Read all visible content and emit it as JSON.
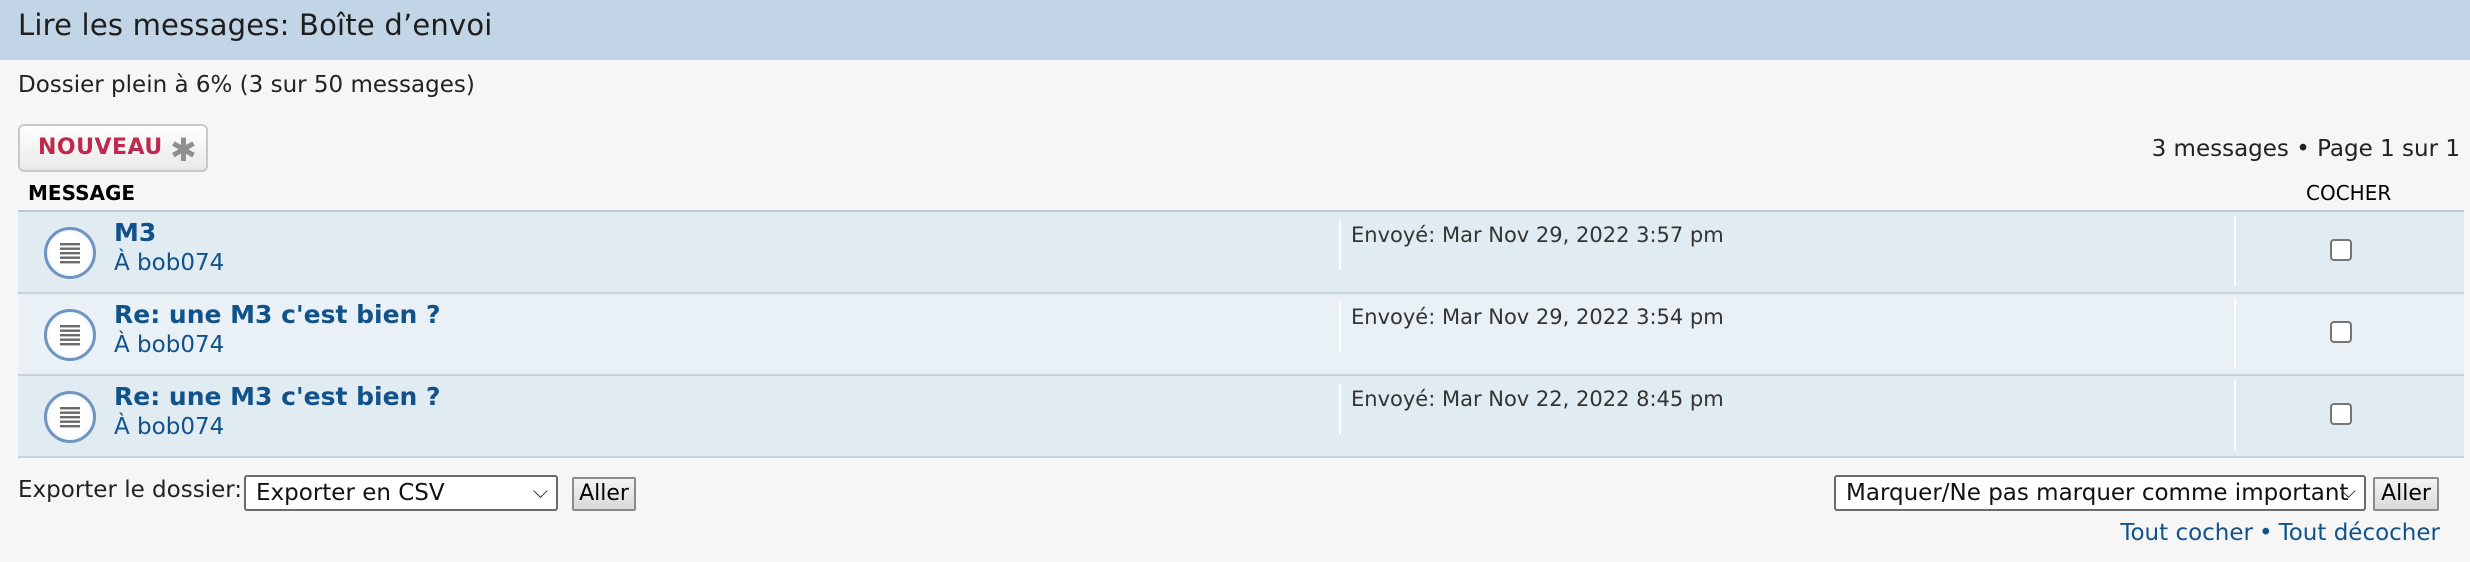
{
  "header": {
    "title": "Lire les messages: Boîte d’envoi"
  },
  "folder": {
    "status": "Dossier plein à 6% (3 sur 50 messages)"
  },
  "toolbar": {
    "new_label": "NOUVEAU",
    "new_icon": "asterisk-icon"
  },
  "pagination": {
    "text": "3 messages • Page 1 sur 1"
  },
  "columns": {
    "message": "MESSAGE",
    "mark": "COCHER"
  },
  "messages": [
    {
      "subject": "M3",
      "to": "À bob074",
      "sent": "Envoyé: Mar Nov 29, 2022 3:57 pm",
      "checked": false
    },
    {
      "subject": "Re: une M3 c'est bien ?",
      "to": "À bob074",
      "sent": "Envoyé: Mar Nov 29, 2022 3:54 pm",
      "checked": false
    },
    {
      "subject": "Re: une M3 c'est bien ?",
      "to": "À bob074",
      "sent": "Envoyé: Mar Nov 22, 2022 8:45 pm",
      "checked": false
    }
  ],
  "export": {
    "label": "Exporter le dossier:",
    "selected": "Exporter en CSV",
    "go_label": "Aller"
  },
  "mark_action": {
    "selected": "Marquer/Ne pas marquer comme important",
    "go_label": "Aller"
  },
  "links": {
    "check_all": "Tout cocher",
    "separator": "•",
    "uncheck_all": "Tout décocher"
  },
  "colors": {
    "header_bg": "#c2d5e6",
    "link": "#105289",
    "new_button_text": "#bc2a4d",
    "row_a": "#e1ebf2",
    "row_b": "#eaf1f6"
  }
}
